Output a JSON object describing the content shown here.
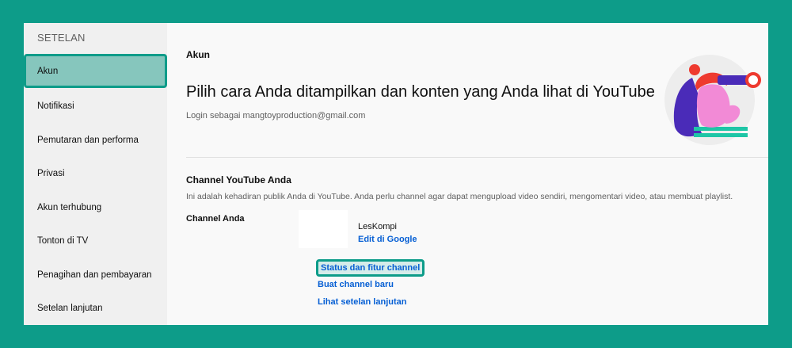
{
  "sidebar": {
    "heading": "SETELAN",
    "items": [
      {
        "label": "Akun",
        "active": true
      },
      {
        "label": "Notifikasi"
      },
      {
        "label": "Pemutaran dan performa"
      },
      {
        "label": "Privasi"
      },
      {
        "label": "Akun terhubung"
      },
      {
        "label": "Tonton di TV"
      },
      {
        "label": "Penagihan dan pembayaran"
      },
      {
        "label": "Setelan lanjutan"
      }
    ]
  },
  "main": {
    "section_label": "Akun",
    "title": "Pilih cara Anda ditampilkan dan konten yang Anda lihat di YouTube",
    "login_text": "Login sebagai mangtoyproduction@gmail.com",
    "channel_section": {
      "heading": "Channel YouTube Anda",
      "description": "Ini adalah kehadiran publik Anda di YouTube. Anda perlu channel agar dapat mengupload video sendiri, mengomentari video, atau membuat playlist.",
      "channel_label": "Channel Anda",
      "channel_name": "LesKompi",
      "edit_link": "Edit di Google",
      "links": [
        {
          "label": "Status dan fitur channel",
          "highlighted": true
        },
        {
          "label": "Buat channel baru"
        },
        {
          "label": "Lihat setelan lanjutan"
        }
      ]
    }
  },
  "colors": {
    "accent": "#0d9c89",
    "link": "#065fd4"
  }
}
